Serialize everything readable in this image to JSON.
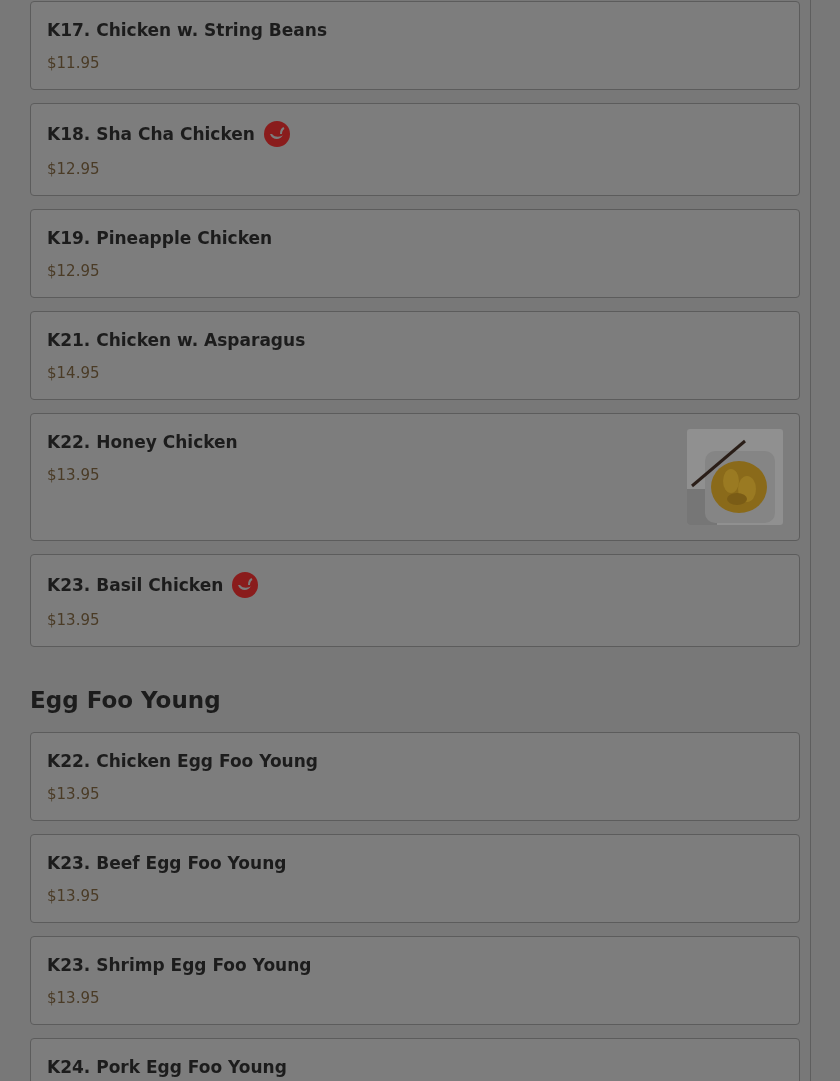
{
  "sections": [
    {
      "items": [
        {
          "name": "K17. Chicken w. String Beans",
          "price": "$11.95",
          "spicy": false,
          "kind": "plain"
        },
        {
          "name": "K18. Sha Cha Chicken",
          "price": "$12.95",
          "spicy": true,
          "kind": "plain"
        },
        {
          "name": "K19. Pineapple Chicken",
          "price": "$12.95",
          "spicy": false,
          "kind": "plain"
        },
        {
          "name": "K21. Chicken w. Asparagus",
          "price": "$14.95",
          "spicy": false,
          "kind": "plain"
        },
        {
          "name": "K22. Honey Chicken",
          "price": "$13.95",
          "spicy": false,
          "kind": "picture"
        },
        {
          "name": "K23. Basil Chicken",
          "price": "$13.95",
          "spicy": true,
          "kind": "plain"
        }
      ]
    },
    {
      "title": "Egg Foo Young",
      "items": [
        {
          "name": "K22. Chicken Egg Foo Young",
          "price": "$13.95",
          "spicy": false,
          "kind": "plain"
        },
        {
          "name": "K23. Beef Egg Foo Young",
          "price": "$13.95",
          "spicy": false,
          "kind": "plain"
        },
        {
          "name": "K23. Shrimp Egg Foo Young",
          "price": "$13.95",
          "spicy": false,
          "kind": "plain"
        },
        {
          "name": "K24. Pork Egg Foo Young",
          "spicy": false,
          "kind": "plain"
        }
      ]
    }
  ]
}
